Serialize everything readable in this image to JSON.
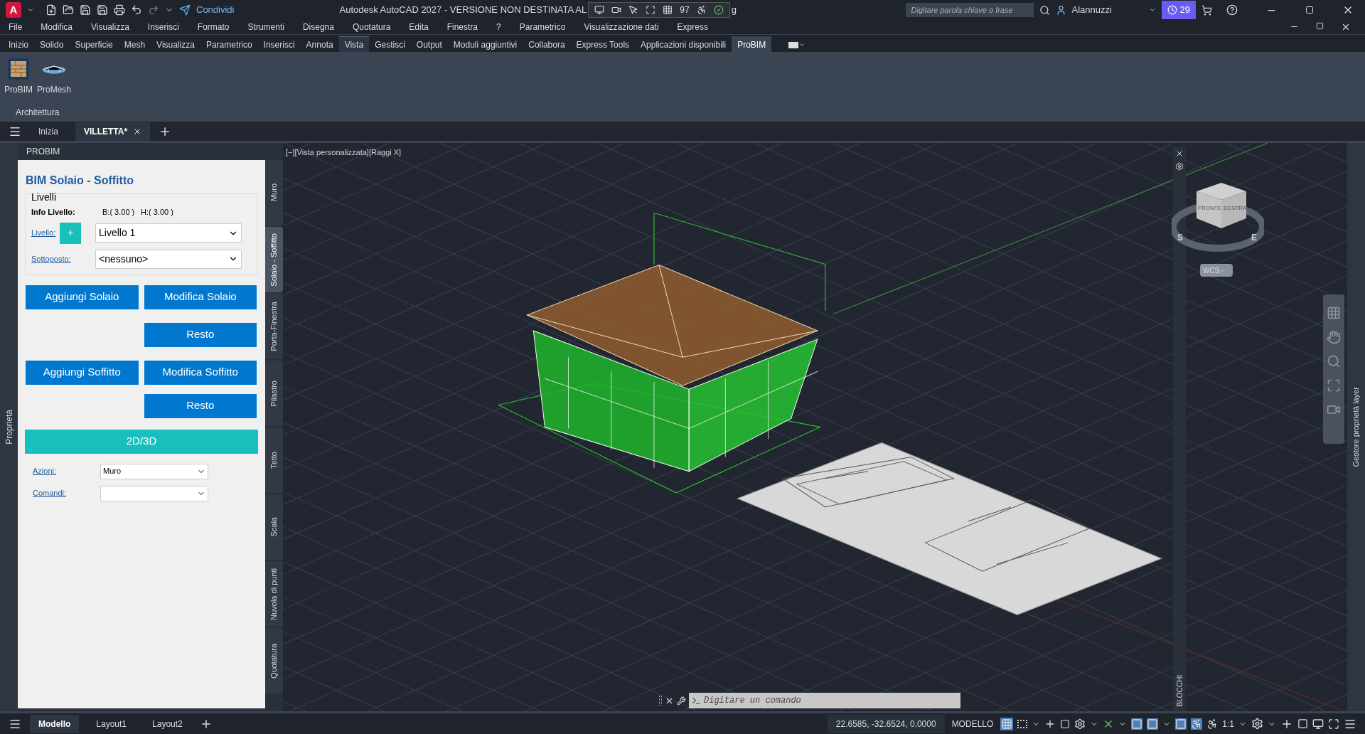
{
  "titlebar": {
    "logo": "A",
    "share": "Condividi",
    "title": "Autodesk AutoCAD 2027 - VERSIONE NON DESTINATA AL",
    "title_tail": "g",
    "dev_count": "97",
    "search": {
      "placeholder": "Digitare parola chiave o frase"
    },
    "user": "Alannuzzi",
    "badge": "29"
  },
  "menu": [
    "File",
    "Modifica",
    "Visualizza",
    "Inserisci",
    "Formato",
    "Strumenti",
    "Disegna",
    "Quotatura",
    "Edita",
    "Finestra",
    "?",
    "Parametrico",
    "Visualizzazione dati",
    "Express"
  ],
  "ribbon_tabs": [
    {
      "label": "Inizio",
      "selected": false,
      "hovered": false
    },
    {
      "label": "Solido",
      "selected": false,
      "hovered": false
    },
    {
      "label": "Superficie",
      "selected": false,
      "hovered": false
    },
    {
      "label": "Mesh",
      "selected": false,
      "hovered": false
    },
    {
      "label": "Visualizza",
      "selected": false,
      "hovered": false
    },
    {
      "label": "Parametrico",
      "selected": false,
      "hovered": false
    },
    {
      "label": "Inserisci",
      "selected": false,
      "hovered": false
    },
    {
      "label": "Annota",
      "selected": false,
      "hovered": false
    },
    {
      "label": "Vista",
      "selected": false,
      "hovered": true
    },
    {
      "label": "Gestisci",
      "selected": false,
      "hovered": false
    },
    {
      "label": "Output",
      "selected": false,
      "hovered": false
    },
    {
      "label": "Moduli aggiuntivi",
      "selected": false,
      "hovered": false
    },
    {
      "label": "Collabora",
      "selected": false,
      "hovered": false
    },
    {
      "label": "Express Tools",
      "selected": false,
      "hovered": false
    },
    {
      "label": "Applicazioni disponibili",
      "selected": false,
      "hovered": false
    },
    {
      "label": "ProBIM",
      "selected": true,
      "hovered": false
    }
  ],
  "ribbon_panel": {
    "buttons": [
      {
        "label": "ProBIM",
        "kind": "bricks"
      },
      {
        "label": "ProMesh",
        "kind": "mesh"
      }
    ],
    "title": "Architettura"
  },
  "file_tabs": [
    {
      "label": "Inizia",
      "selected": false
    },
    {
      "label": "VILLETTA*",
      "selected": true
    }
  ],
  "left_strip": "Proprietà",
  "palette": {
    "header": "PROBIM",
    "title": "BIM Solaio - Soffitto",
    "group": "Livelli",
    "info_label": "Info Livello:",
    "info_b": "B:( 3.00 )",
    "info_h": "H:( 3.00 )",
    "level_link": "Livello:",
    "add": "+",
    "level_value": "Livello 1",
    "under_link": "Sottoposto:",
    "under_value": "<nessuno>",
    "button_rows": [
      {
        "left": "Aggiungi Solaio",
        "right": "Modifica Solaio"
      },
      {
        "right": "Resto"
      },
      {
        "left": "Aggiungi Soffitto",
        "right": "Modifica Soffitto"
      },
      {
        "right": "Resto"
      }
    ],
    "toggle": "2D/3D",
    "actions_link": "Azioni:",
    "actions_value": "Muro",
    "commands_link": "Comandi:"
  },
  "vertical_tabs": [
    {
      "label": "Muro",
      "selected": false
    },
    {
      "label": "Solaio - Soffitto",
      "selected": true
    },
    {
      "label": "Porta-Finestra",
      "selected": false
    },
    {
      "label": "Pilastro",
      "selected": false
    },
    {
      "label": "Tetto",
      "selected": false
    },
    {
      "label": "Scala",
      "selected": false
    },
    {
      "label": "Nuvola di punti",
      "selected": false
    },
    {
      "label": "Quotatura",
      "selected": false
    }
  ],
  "viewport": {
    "label": "[−][Vista personalizzata][Raggi X]",
    "cube_front": "FRONTE",
    "cube_right": "DESTRA",
    "compass": [
      "S",
      "E"
    ],
    "wcs": "WCS",
    "side_label": "BLOCCHI",
    "command": {
      "placeholder": "Digitare un comando"
    }
  },
  "right_strip": "Gestore proprietà layer",
  "layout_tabs": [
    {
      "label": "Modello",
      "selected": true
    },
    {
      "label": "Layout1",
      "selected": false
    },
    {
      "label": "Layout2",
      "selected": false
    }
  ],
  "status": {
    "coords": "22.6585, -32.6524, 0.0000",
    "space": "MODELLO",
    "scale": "1:1"
  }
}
